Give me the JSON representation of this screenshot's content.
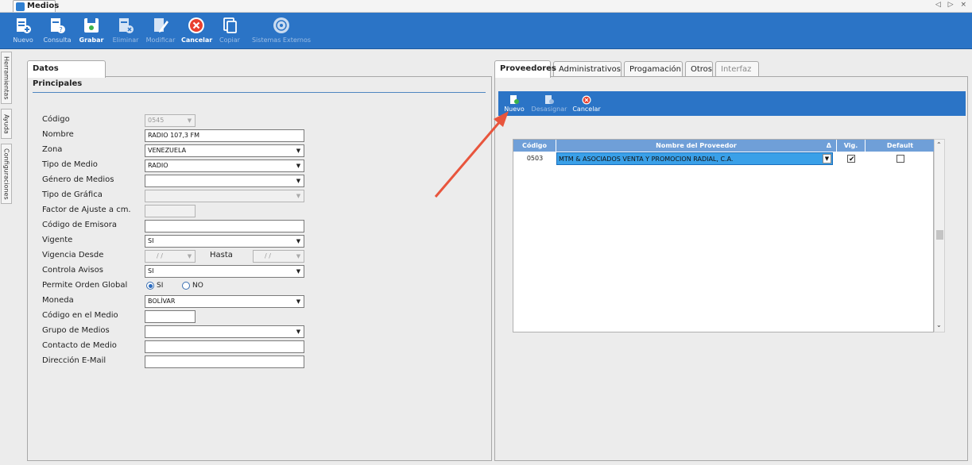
{
  "window": {
    "tab_title": "Medios",
    "controls": "◁ ▷ ×"
  },
  "toolbar": {
    "nuevo": "Nuevo",
    "consulta": "Consulta",
    "grabar": "Grabar",
    "eliminar": "Eliminar",
    "modificar": "Modificar",
    "cancelar": "Cancelar",
    "copiar": "Copiar",
    "sistemas_externos": "Sistemas Externos"
  },
  "side_tabs": {
    "herramientas": "Herramientas",
    "ayuda": "Ayuda",
    "configuraciones": "Configuraciones"
  },
  "left_panel": {
    "tab": "Datos Principales",
    "labels": {
      "codigo": "Código",
      "nombre": "Nombre",
      "zona": "Zona",
      "tipo_medio": "Tipo de Medio",
      "genero_medios": "Género de Medios",
      "tipo_grafica": "Tipo de Gráfica",
      "factor_ajuste": "Factor de Ajuste a cm.",
      "codigo_emisora": "Código de Emisora",
      "vigente": "Vigente",
      "vigencia_desde": "Vigencia Desde",
      "hasta": "Hasta",
      "controla_avisos": "Controla Avisos",
      "permite_orden_global": "Permite Orden Global",
      "moneda": "Moneda",
      "codigo_medio": "Código en el Medio",
      "grupo_medios": "Grupo de Medios",
      "contacto_medio": "Contacto de Medio",
      "direccion_email": "Dirección E-Mail"
    },
    "values": {
      "codigo": "0545",
      "nombre": "RADIO 107,3 FM",
      "zona": "VENEZUELA",
      "tipo_medio": "RADIO",
      "genero_medios": "",
      "tipo_grafica": "",
      "factor_ajuste": "",
      "codigo_emisora": "",
      "vigente": "SI",
      "vigencia_desde": "/ /",
      "hasta": "/ /",
      "controla_avisos": "SI",
      "moneda": "BOLÍVAR",
      "codigo_medio": "",
      "grupo_medios": "",
      "contacto_medio": "",
      "direccion_email": ""
    },
    "radio": {
      "si": "SI",
      "no": "NO",
      "selected": "SI"
    }
  },
  "right_panel": {
    "tabs": [
      "Proveedores",
      "Administrativos",
      "Progamación",
      "Otros",
      "Interfaz"
    ],
    "active_tab": "Proveedores",
    "toolbar": {
      "nuevo": "Nuevo",
      "desasignar": "Desasignar",
      "cancelar": "Cancelar"
    },
    "grid": {
      "headers": {
        "codigo": "Código",
        "nombre": "Nombre del Proveedor",
        "vig": "Vig.",
        "default": "Default",
        "sort_mark": "Δ"
      },
      "rows": [
        {
          "codigo": "0503",
          "nombre": "MTM & ASOCIADOS VENTA Y PROMOCION RADIAL, C.A.",
          "vig": true,
          "default": false
        }
      ]
    }
  },
  "colors": {
    "toolbar_blue": "#2b74c6",
    "grid_header": "#6f9fd8",
    "selected_cell": "#3aa0e8",
    "arrow": "#e8553d"
  }
}
